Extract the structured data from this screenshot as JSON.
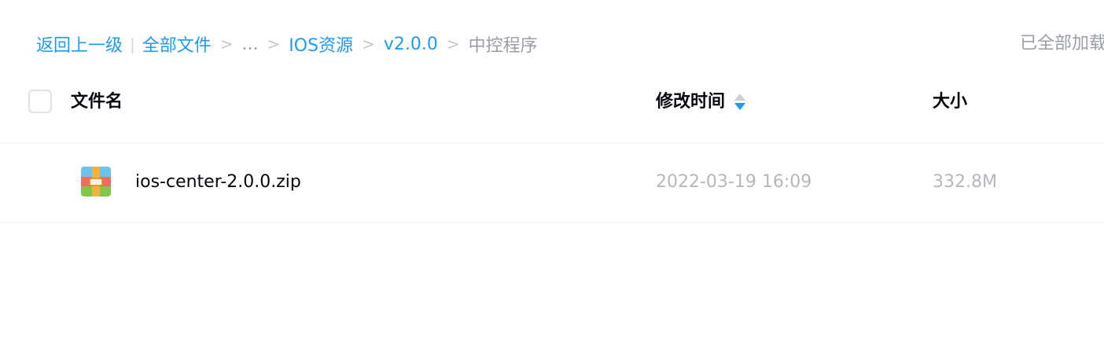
{
  "breadcrumb": {
    "back": "返回上一级",
    "divider": "|",
    "root": "全部文件",
    "separator": ">",
    "ellipsis": "...",
    "level1": "IOS资源",
    "level2": "v2.0.0",
    "current": "中控程序"
  },
  "status": {
    "load_text": "已全部加载"
  },
  "table": {
    "columns": {
      "name": "文件名",
      "mtime": "修改时间",
      "size": "大小"
    },
    "sort": {
      "column": "mtime",
      "direction": "descending"
    },
    "rows": [
      {
        "icon": "zip-archive-icon",
        "name": "ios-center-2.0.0.zip",
        "mtime": "2022-03-19 16:09",
        "size": "332.8M"
      }
    ]
  },
  "colors": {
    "link": "#1d9bf0",
    "muted": "#9a9ea7",
    "text": "#05080f",
    "value": "#b3b7be"
  }
}
